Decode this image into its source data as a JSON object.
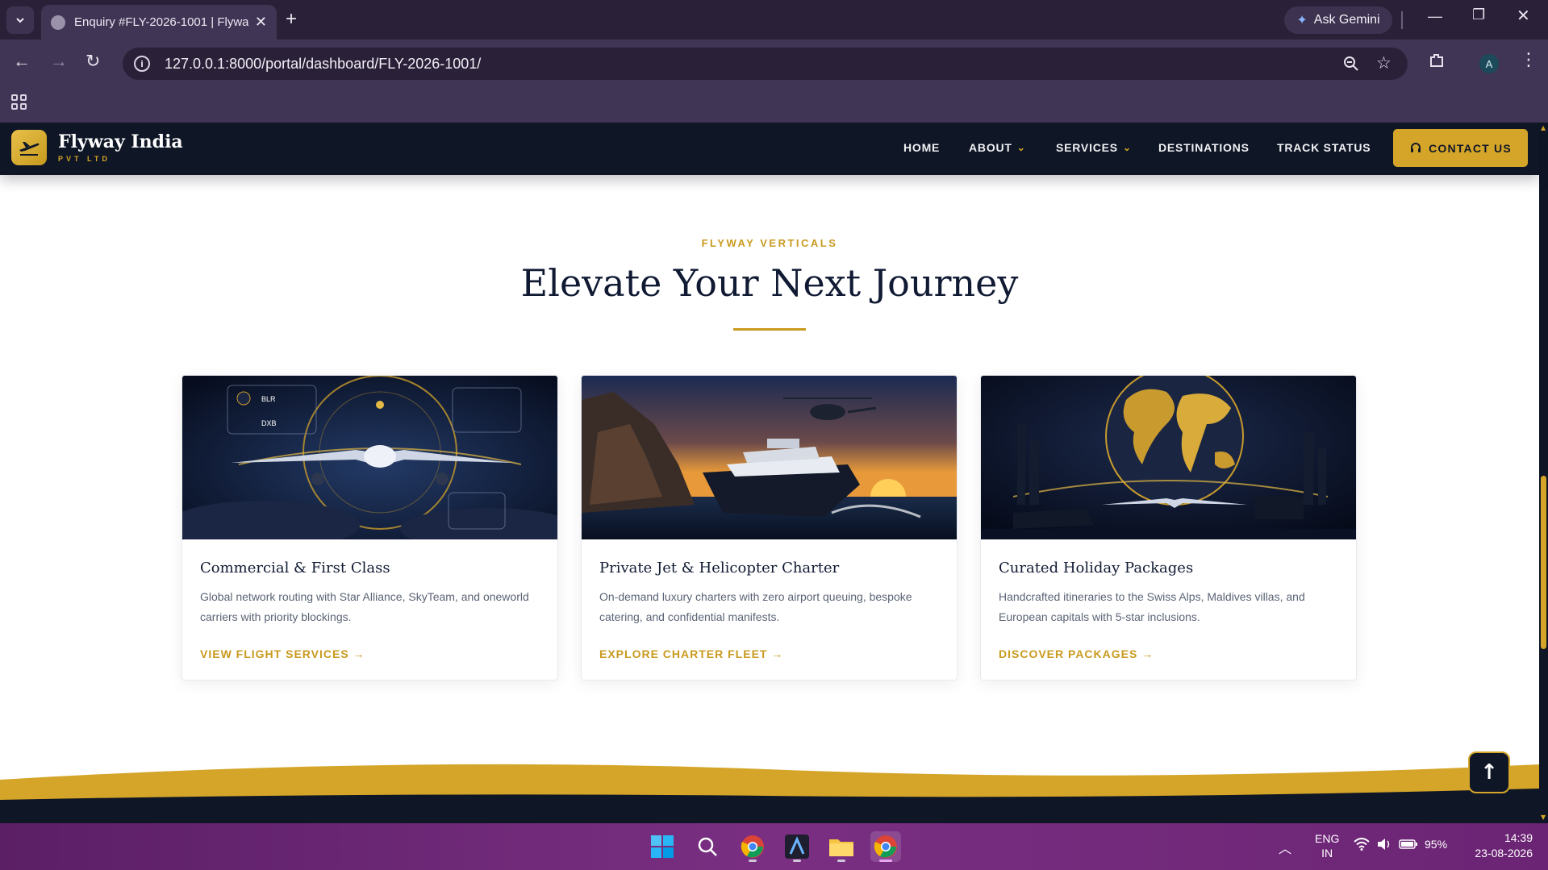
{
  "browser": {
    "tab_title": "Enquiry #FLY-2026-1001 | Flyway",
    "new_tab_symbol": "+",
    "gemini_label": "Ask Gemini",
    "url": "127.0.0.1:8000/portal/dashboard/FLY-2026-1001/",
    "profile_initial": "A"
  },
  "site": {
    "brand_name": "Flyway India",
    "brand_sub": "PVT LTD",
    "nav": {
      "home": "HOME",
      "about": "ABOUT",
      "services": "SERVICES",
      "destinations": "DESTINATIONS",
      "track": "TRACK STATUS"
    },
    "contact_label": "CONTACT US",
    "eyebrow": "FLYWAY VERTICALS",
    "headline": "Elevate Your Next Journey",
    "cards": [
      {
        "title": "Commercial & First Class",
        "description": "Global network routing with Star Alliance, SkyTeam, and oneworld carriers with priority blockings.",
        "link": "VIEW FLIGHT SERVICES →",
        "image_labels": {
          "from_code": "BLR",
          "to_code": "DXB"
        }
      },
      {
        "title": "Private Jet & Helicopter Charter",
        "description": "On-demand luxury charters with zero airport queuing, bespoke catering, and confidential manifests.",
        "link": "EXPLORE CHARTER FLEET →"
      },
      {
        "title": "Curated Holiday Packages",
        "description": "Handcrafted itineraries to the Swiss Alps, Maldives villas, and European capitals with 5-star inclusions.",
        "link": "DISCOVER PACKAGES →"
      }
    ]
  },
  "taskbar": {
    "lang_top": "ENG",
    "lang_bottom": "IN",
    "battery": "95%",
    "time": "14:39",
    "date": "23-08-2026"
  },
  "colors": {
    "gold": "#d4a528",
    "navy": "#0f1626",
    "chrome": "#403554"
  },
  "icons": [
    "tab-list-icon",
    "globe-icon",
    "close-icon",
    "back-icon",
    "forward-icon",
    "reload-icon",
    "info-icon",
    "zoom-icon",
    "star-icon",
    "extensions-icon",
    "menu-icon",
    "apps-icon",
    "plane-icon",
    "headset-icon",
    "arrow-up-icon",
    "windows-icon",
    "search-icon",
    "chrome-icon",
    "wifi-icon",
    "volume-icon",
    "battery-icon"
  ]
}
